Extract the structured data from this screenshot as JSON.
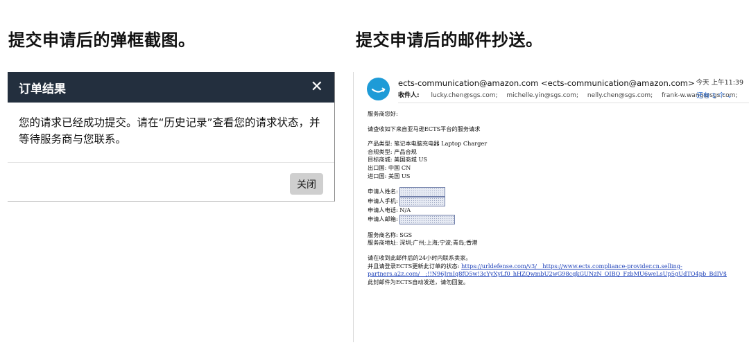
{
  "captions": {
    "left": "提交申请后的弹框截图。",
    "right": "提交申请后的邮件抄送。"
  },
  "modal": {
    "title": "订单结果",
    "close_icon": "close-icon",
    "message_line1": "您的请求已经成功提交。请在“历史记录”查看您的请求状态，并",
    "message_line2": "等待服务商与您联系。",
    "close_button": "关闭"
  },
  "email": {
    "avatar_icon": "amazon-smile-icon",
    "from": "ects-communication@amazon.com <ects-communication@amazon.com>",
    "time": "今天 上午11:39",
    "to_label": "收件人:",
    "recipients": [
      "lucky.chen@sgs.com;",
      "michelle.yin@sgs.com;",
      "nelly.chen@sgs.com;",
      "frank-w.wang@sgs.com;"
    ],
    "more": "还有 1 个 ⌄",
    "greeting": "服务商您好:",
    "intro": "请查收如下来自亚马逊ECTS平台的服务请求",
    "product_type": "产品类型: 笔记本电脑充电器 Laptop Charger",
    "compliance_type": "合规类型: 产品合规",
    "target_market": "目标商城: 美国商城 US",
    "export_country": "出口国: 中国 CN",
    "import_country": "进口国: 美国 US",
    "applicant_name_label": "申请人姓名:",
    "applicant_mobile_label": "申请人手机:",
    "applicant_phone": "申请人电话: N/A",
    "applicant_email_label": "申请人邮箱:",
    "provider_name": "服务商名称: SGS",
    "provider_address": "服务商地址: 深圳;广州;上海;宁波;青岛;香港",
    "contact_note": "请在收到此邮件后的24小时内联系卖家。",
    "login_note": "并且请登录ECTS更新此订单的状态:",
    "link_part1": "https://urldefense.com/v3/__https://www.ects.compliance-provider.cn.selling-",
    "link_part2": "partners.a2z.com/__;!!N96JrnIq8fO5w!3cYyXyLf0_hHZQwmbU2wG98cqkGUNzN_OIBQ_FzbMU6weLsUp5gUdTO4pb_BdIV$",
    "auto_note": "此封邮件为ECTS自动发送，请勿回复。"
  }
}
